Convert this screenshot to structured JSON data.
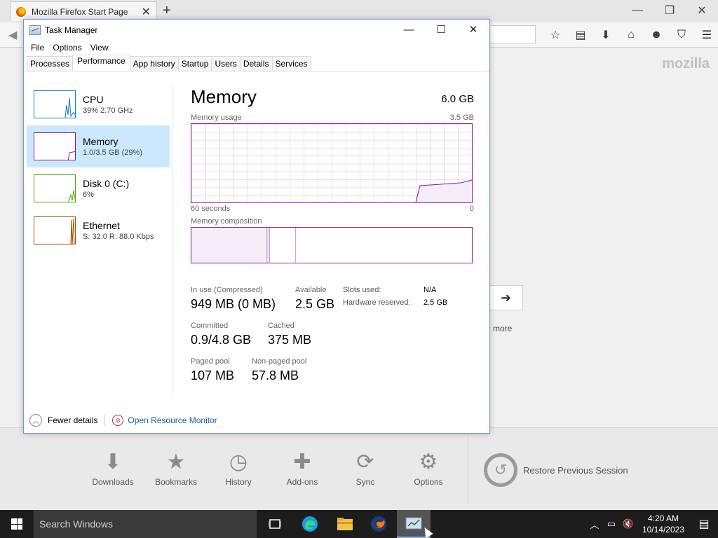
{
  "firefox": {
    "tab_title": "Mozilla Firefox Start Page",
    "tab_close": "✕",
    "new_tab": "+",
    "brand": "mozilla",
    "more_label": "more",
    "launcher": [
      {
        "label": "Downloads",
        "icon": "download-icon"
      },
      {
        "label": "Bookmarks",
        "icon": "bookmark-star-icon"
      },
      {
        "label": "History",
        "icon": "clock-icon"
      },
      {
        "label": "Add-ons",
        "icon": "puzzle-icon"
      },
      {
        "label": "Sync",
        "icon": "sync-icon"
      },
      {
        "label": "Options",
        "icon": "gear-icon"
      }
    ],
    "restore_label": "Restore Previous Session"
  },
  "taskmgr": {
    "title": "Task Manager",
    "menu": [
      "File",
      "Options",
      "View"
    ],
    "tabs": [
      "Processes",
      "Performance",
      "App history",
      "Startup",
      "Users",
      "Details",
      "Services"
    ],
    "active_tab": "Performance",
    "sidebar": [
      {
        "name": "CPU",
        "sub": "39%  2.70 GHz",
        "color": "#117dbb"
      },
      {
        "name": "Memory",
        "sub": "1.0/3.5 GB (29%)",
        "color": "#8b12ae",
        "selected": true
      },
      {
        "name": "Disk 0 (C:)",
        "sub": "6%",
        "color": "#4da60c"
      },
      {
        "name": "Ethernet",
        "sub": "S: 32.0  R: 88.0 Kbps",
        "color": "#a74f01"
      }
    ],
    "main": {
      "title": "Memory",
      "total": "6.0 GB",
      "usage_label": "Memory usage",
      "usage_max": "3.5 GB",
      "time_left": "60 seconds",
      "time_right": "0",
      "composition_label": "Memory composition",
      "in_use_label": "In use (Compressed)",
      "in_use_value": "949 MB (0 MB)",
      "available_label": "Available",
      "available_value": "2.5 GB",
      "slots_label": "Slots used:",
      "slots_value": "N/A",
      "hw_reserved_label": "Hardware reserved:",
      "hw_reserved_value": "2.5 GB",
      "committed_label": "Committed",
      "committed_value": "0.9/4.8 GB",
      "cached_label": "Cached",
      "cached_value": "375 MB",
      "paged_label": "Paged pool",
      "paged_value": "107 MB",
      "nonpaged_label": "Non-paged pool",
      "nonpaged_value": "57.8 MB"
    },
    "footer": {
      "fewer_details": "Fewer details",
      "open_resource_monitor": "Open Resource Monitor"
    }
  },
  "taskbar": {
    "search_placeholder": "Search Windows",
    "time": "4:20 AM",
    "date": "10/14/2023"
  },
  "colors": {
    "memory_accent": "#8b12ae",
    "taskbar_bg": "#1d1d1d",
    "link": "#1a5fb4"
  }
}
